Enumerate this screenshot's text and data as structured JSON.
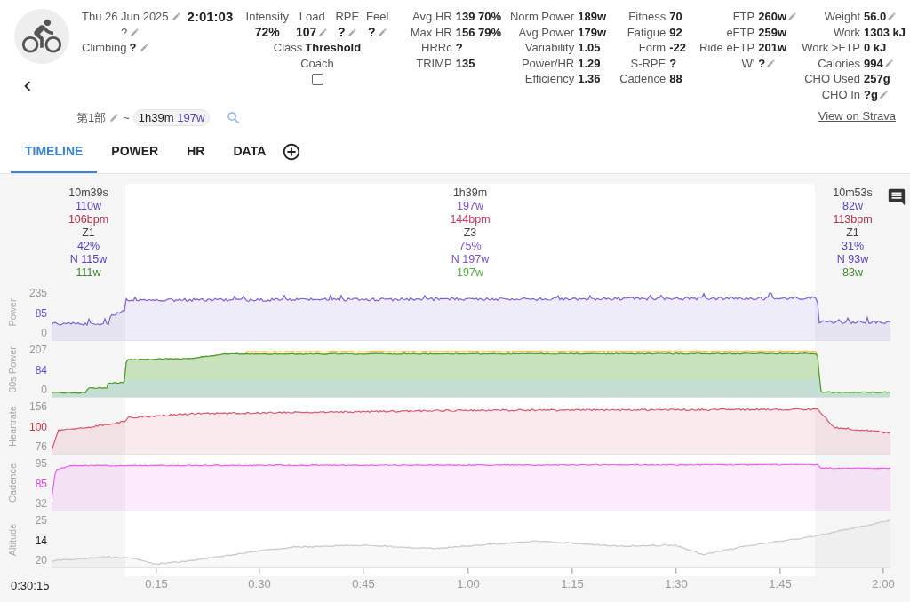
{
  "header": {
    "date": "Thu 26 Jun 2025",
    "duration": "2:01:03",
    "name": "?",
    "climbing": {
      "label": "Climbing",
      "value": "?"
    }
  },
  "scores": [
    {
      "label": "Intensity",
      "value": "72%",
      "editable": false
    },
    {
      "label": "Load",
      "value": "107",
      "editable": true
    },
    {
      "label": "RPE",
      "value": "?",
      "editable": true
    },
    {
      "label": "Feel",
      "value": "?",
      "editable": true
    }
  ],
  "class": {
    "label": "Class",
    "value": "Threshold"
  },
  "coach": {
    "label": "Coach",
    "checked": false
  },
  "stat_columns": [
    [
      {
        "label": "Avg HR",
        "value": "139 70%",
        "editable": false
      },
      {
        "label": "Max HR",
        "value": "156 79%",
        "editable": false
      },
      {
        "label": "HRRc",
        "value": "?",
        "editable": false
      },
      {
        "label": "TRIMP",
        "value": "135",
        "editable": false
      }
    ],
    [
      {
        "label": "Norm Power",
        "value": "189w",
        "editable": false
      },
      {
        "label": "Avg Power",
        "value": "179w",
        "editable": false
      },
      {
        "label": "Variability",
        "value": "1.05",
        "editable": false
      },
      {
        "label": "Power/HR",
        "value": "1.29",
        "editable": false
      },
      {
        "label": "Efficiency",
        "value": "1.36",
        "editable": false
      }
    ],
    [
      {
        "label": "Fitness",
        "value": "70",
        "editable": false
      },
      {
        "label": "Fatigue",
        "value": "92",
        "editable": false
      },
      {
        "label": "Form",
        "value": "-22",
        "editable": false
      },
      {
        "label": "S-RPE",
        "value": "?",
        "editable": false
      },
      {
        "label": "Cadence",
        "value": "88",
        "editable": false
      }
    ],
    [
      {
        "label": "FTP",
        "value": "260w",
        "editable": true
      },
      {
        "label": "eFTP",
        "value": "259w",
        "editable": false
      },
      {
        "label": "Ride eFTP",
        "value": "201w",
        "editable": false
      },
      {
        "label": "W'",
        "value": "?",
        "editable": true
      }
    ],
    [
      {
        "label": "Weight",
        "value": "56.0",
        "editable": true
      },
      {
        "label": "Work",
        "value": "1303 kJ",
        "editable": false
      },
      {
        "label": "Work >FTP",
        "value": "0 kJ",
        "editable": false
      },
      {
        "label": "Calories",
        "value": "994",
        "editable": true
      },
      {
        "label": "CHO Used",
        "value": "257g",
        "editable": false
      },
      {
        "label": "CHO In",
        "value": "?g",
        "editable": true
      }
    ]
  ],
  "strava_link": "View on Strava",
  "segment": {
    "name": "第1部",
    "separator": "~",
    "duration": "1h39m",
    "power": "197w"
  },
  "tabs": [
    {
      "label": "TIMELINE",
      "selected": true
    },
    {
      "label": "POWER",
      "selected": false
    },
    {
      "label": "HR",
      "selected": false
    },
    {
      "label": "DATA",
      "selected": false
    }
  ],
  "intervals": [
    {
      "duration": "10m39s",
      "power": "110w",
      "hr": "106bpm",
      "zone": "Z1",
      "intensity": "42%",
      "norm_power": "N 115w",
      "avg_30s": "111w",
      "selected": false
    },
    {
      "duration": "1h39m",
      "power": "197w",
      "hr": "144bpm",
      "zone": "Z3",
      "intensity": "75%",
      "norm_power": "N 197w",
      "avg_30s": "197w",
      "selected": true
    },
    {
      "duration": "10m53s",
      "power": "82w",
      "hr": "113bpm",
      "zone": "Z1",
      "intensity": "31%",
      "norm_power": "N 93w",
      "avg_30s": "83w",
      "selected": false
    }
  ],
  "panels": [
    {
      "kind": "power",
      "label": "Power",
      "ticks": [
        "235",
        "85",
        "0"
      ],
      "color": "#7d5fd8"
    },
    {
      "kind": "power30",
      "label": "30s Power",
      "ticks": [
        "207",
        "84",
        "0"
      ],
      "color": "#4b9a2f"
    },
    {
      "kind": "hr",
      "label": "Heartrate",
      "ticks": [
        "156",
        "100",
        "76"
      ],
      "color": "#d9566b"
    },
    {
      "kind": "cadence",
      "label": "Cadence",
      "ticks": [
        "95",
        "85",
        "32"
      ],
      "color": "#ec5ef0"
    },
    {
      "kind": "altitude",
      "label": "Altitude",
      "ticks": [
        "25",
        "14",
        "20"
      ],
      "color": "#c8c8c8"
    }
  ],
  "x_axis": {
    "start": "0:30:15",
    "ticks": [
      "0:15",
      "0:30",
      "0:45",
      "1:00",
      "1:15",
      "1:30",
      "1:45",
      "2:00"
    ]
  }
}
